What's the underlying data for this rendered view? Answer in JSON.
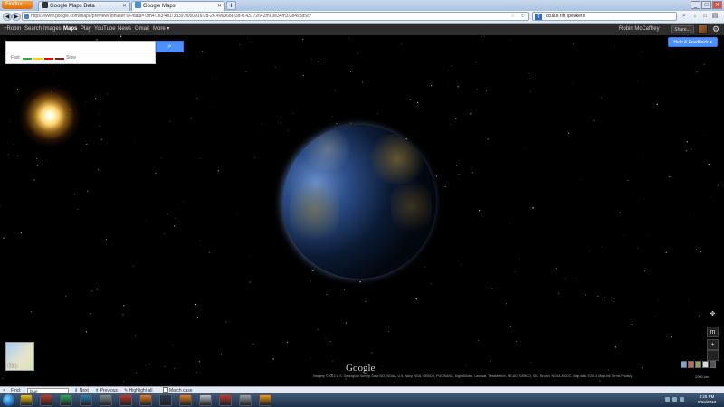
{
  "browser": {
    "menu_button": "Firefox",
    "tabs": [
      {
        "label": "Google Maps Beta",
        "favicon_color": "#333333",
        "active": false
      },
      {
        "label": "Google Maps",
        "favicon_color": "#4a90d9",
        "active": true
      }
    ],
    "new_tab_label": "+",
    "back_label": "◀",
    "forward_label": "▶",
    "url": "https://www.google.com/maps/preview/\\ldhuser:0F/data=!3m4!1e3!4b1!3d39.9050916!2d-26.4963688!3d-0.43772642mI!3e34m3!3d4s8d5c7",
    "search_value": "oculus rift speakers",
    "search_engine": "g"
  },
  "gbar": {
    "items": [
      "+Robin",
      "Search",
      "Images",
      "Maps",
      "Play",
      "YouTube",
      "News",
      "Gmail",
      "More ▾"
    ],
    "active_index": 3,
    "user_name": "Robin McCaffrey",
    "share_label": "Share..."
  },
  "search": {
    "value": "",
    "placeholder": "",
    "button_icon": "search-icon"
  },
  "traffic": {
    "fast_label": "Fast",
    "slow_label": "Slow",
    "colors": [
      "#30ac3e",
      "#ffcf00",
      "#ff0000",
      "#811f1f"
    ]
  },
  "help_button": "Help & Feedback ▾",
  "map": {
    "thumbnail_label": "Map",
    "logo": "Google",
    "attribution": "Imagery ©2013 U.S. Geological Survey, Data SIO, NOAA, U.S. Navy, NGA, GEBCO, PGC/NASA, DigitalGlobe, Landsat, TerraMetrics, IBCAO, GEBCO, SIO, Brunei, NOAA-NGDC, Map data ©2013 MapLink   Terms   Privacy",
    "scale": "2000 km",
    "zoom_in": "+",
    "zoom_out": "−",
    "zoom_mode": "m"
  },
  "findbar": {
    "close": "×",
    "label": "Find:",
    "value": "blue",
    "next": "Next",
    "previous": "Previous",
    "highlight": "Highlight all",
    "match_case": "Match case"
  },
  "taskbar": {
    "time": "4:25 PM",
    "date": "5/16/2013",
    "icons": [
      "#f1c40f",
      "#c0392b",
      "#27ae60",
      "#2980b9",
      "#7f8c8d",
      "#c0392b",
      "#e67e22",
      "#2c3e50",
      "#e67e22",
      "#bdc3c7",
      "#c0392b",
      "#95a5a6",
      "#f39c12"
    ]
  }
}
